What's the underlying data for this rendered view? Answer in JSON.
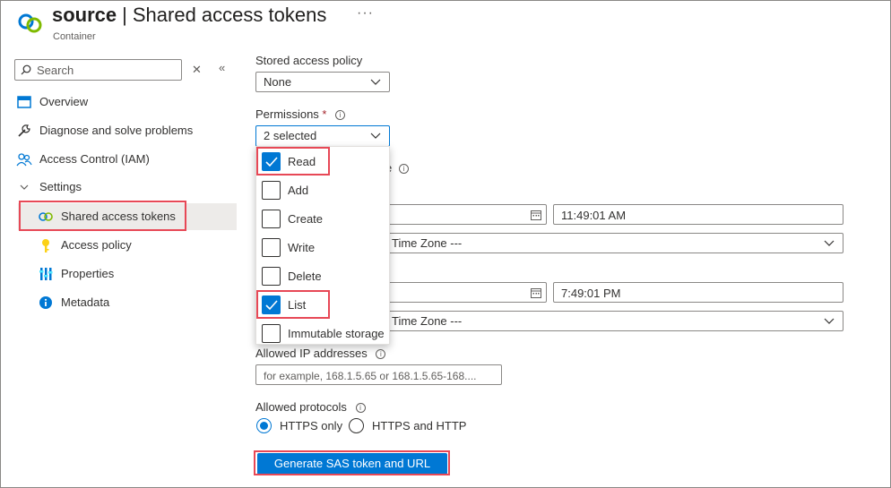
{
  "header": {
    "resource_name": "source",
    "separator": "|",
    "page_title": "Shared access tokens",
    "more_label": "···",
    "subtitle": "Container"
  },
  "sidebar": {
    "search_placeholder": "Search",
    "items": [
      {
        "label": "Overview",
        "icon": "overview-icon"
      },
      {
        "label": "Diagnose and solve problems",
        "icon": "wrench-icon"
      },
      {
        "label": "Access Control (IAM)",
        "icon": "people-icon"
      },
      {
        "label": "Settings",
        "icon": "chevron-down-icon"
      },
      {
        "label": "Shared access tokens",
        "icon": "link-icon",
        "active": true
      },
      {
        "label": "Access policy",
        "icon": "key-icon"
      },
      {
        "label": "Properties",
        "icon": "properties-icon"
      },
      {
        "label": "Metadata",
        "icon": "info-icon"
      }
    ]
  },
  "form": {
    "stored_policy_label": "Stored access policy",
    "stored_policy_value": "None",
    "permissions_label": "Permissions",
    "required_mark": "*",
    "permissions_value": "2 selected",
    "permission_options": [
      {
        "label": "Read",
        "checked": true
      },
      {
        "label": "Add",
        "checked": false
      },
      {
        "label": "Create",
        "checked": false
      },
      {
        "label": "Write",
        "checked": false
      },
      {
        "label": "Delete",
        "checked": false
      },
      {
        "label": "List",
        "checked": true
      },
      {
        "label": "Immutable storage",
        "checked": false
      }
    ],
    "start_time": "11:49:01 AM",
    "start_timezone": "Time Zone ---",
    "expiry_time": "7:49:01 PM",
    "expiry_timezone": "Time Zone ---",
    "partial_label_char": "e",
    "allowed_ip_label": "Allowed IP addresses",
    "allowed_ip_placeholder": "for example, 168.1.5.65 or 168.1.5.65-168....",
    "protocols_label": "Allowed protocols",
    "protocol_options": [
      {
        "label": "HTTPS only",
        "selected": true
      },
      {
        "label": "HTTPS and HTTP",
        "selected": false
      }
    ],
    "generate_button": "Generate SAS token and URL"
  },
  "colors": {
    "accent": "#0078d4",
    "highlight_box": "#e74856",
    "required": "#a4262c"
  }
}
